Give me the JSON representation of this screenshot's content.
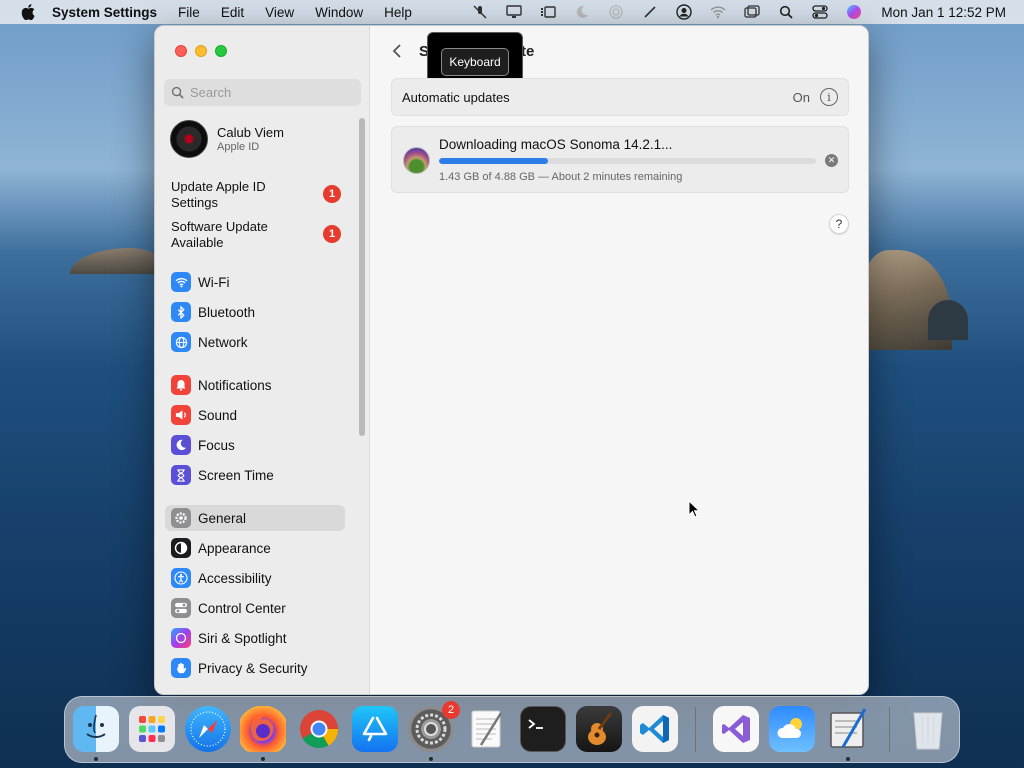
{
  "menubar": {
    "app_name": "System Settings",
    "menus": [
      "File",
      "Edit",
      "View",
      "Window",
      "Help"
    ],
    "clock": "Mon Jan 1  12:52 PM",
    "status_icons": [
      "mic-mute-icon",
      "display-icon",
      "stage-manager-icon",
      "focus-moon-icon",
      "airdrop-icon",
      "pen-icon",
      "user-icon",
      "wifi-icon",
      "screen-mirroring-icon",
      "search-icon",
      "control-center-icon",
      "siri-icon"
    ]
  },
  "sidebar": {
    "search_placeholder": "Search",
    "profile": {
      "name": "Calub Viem",
      "subtitle": "Apple ID"
    },
    "alerts": [
      {
        "label": "Update Apple ID Settings",
        "badge": "1"
      },
      {
        "label": "Software Update Available",
        "badge": "1"
      }
    ],
    "items": [
      {
        "label": "Wi-Fi",
        "icon": "wifi-icon",
        "color": "#2f88f7"
      },
      {
        "label": "Bluetooth",
        "icon": "bluetooth-icon",
        "color": "#2f88f7"
      },
      {
        "label": "Network",
        "icon": "globe-icon",
        "color": "#2f88f7"
      },
      {
        "label": "Notifications",
        "icon": "bell-icon",
        "color": "#f0443a"
      },
      {
        "label": "Sound",
        "icon": "speaker-icon",
        "color": "#f0443a"
      },
      {
        "label": "Focus",
        "icon": "moon-icon",
        "color": "#5b4fd6"
      },
      {
        "label": "Screen Time",
        "icon": "hourglass-icon",
        "color": "#5b4fd6"
      },
      {
        "label": "General",
        "icon": "gear-icon",
        "color": "#8e8e93",
        "selected": true
      },
      {
        "label": "Appearance",
        "icon": "appearance-icon",
        "color": "#1c1c1e"
      },
      {
        "label": "Accessibility",
        "icon": "accessibility-icon",
        "color": "#2f88f7"
      },
      {
        "label": "Control Center",
        "icon": "toggles-icon",
        "color": "#8e8e93"
      },
      {
        "label": "Siri & Spotlight",
        "icon": "siri-icon",
        "color": "#7b3fe4"
      },
      {
        "label": "Privacy & Security",
        "icon": "hand-icon",
        "color": "#2f88f7"
      }
    ]
  },
  "content": {
    "title_partial": "S",
    "title_end": "te",
    "tooltip": "Keyboard",
    "automatic_updates": {
      "label": "Automatic updates",
      "value": "On"
    },
    "download": {
      "title": "Downloading macOS Sonoma 14.2.1...",
      "progress": 0.29,
      "subtitle": "1.43 GB of 4.88 GB — About 2 minutes remaining"
    },
    "help": "?"
  },
  "dock": {
    "apps": [
      {
        "name": "Finder",
        "icon": "finder-icon",
        "running": true
      },
      {
        "name": "Launchpad",
        "icon": "launchpad-icon",
        "running": false
      },
      {
        "name": "Safari",
        "icon": "safari-icon",
        "running": false
      },
      {
        "name": "Firefox",
        "icon": "firefox-icon",
        "running": true
      },
      {
        "name": "Chrome",
        "icon": "chrome-icon",
        "running": false
      },
      {
        "name": "App Store",
        "icon": "app-store-icon",
        "running": false
      },
      {
        "name": "System Settings",
        "icon": "system-settings-icon",
        "running": true,
        "badge": "2"
      },
      {
        "name": "TextEdit",
        "icon": "textedit-icon",
        "running": false
      },
      {
        "name": "Terminal",
        "icon": "terminal-icon",
        "running": false
      },
      {
        "name": "GarageBand",
        "icon": "garageband-icon",
        "running": false
      },
      {
        "name": "VS Code",
        "icon": "vscode-icon",
        "running": false
      },
      {
        "name": "Visual Studio",
        "icon": "visual-studio-icon",
        "running": false
      },
      {
        "name": "Weather",
        "icon": "weather-icon",
        "running": false
      },
      {
        "name": "Script Editor",
        "icon": "script-editor-icon",
        "running": true
      },
      {
        "name": "Trash",
        "icon": "trash-icon",
        "running": false
      }
    ]
  }
}
